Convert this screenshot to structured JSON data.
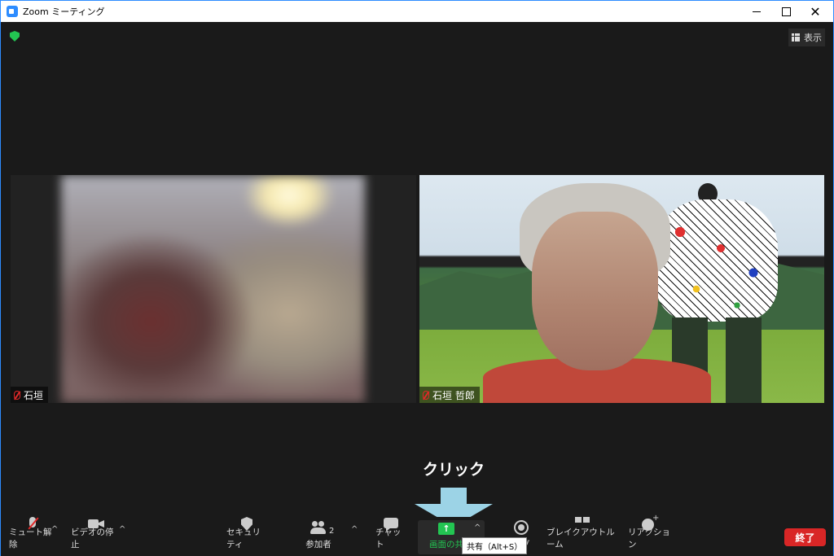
{
  "window": {
    "title": "Zoom ミーティング"
  },
  "meeting": {
    "view_label": "表示",
    "participants": [
      {
        "name": "石垣",
        "muted": true
      },
      {
        "name": "石垣 哲郎",
        "muted": true
      }
    ]
  },
  "annotation": {
    "label": "クリック"
  },
  "toolbar": {
    "mute_label": "ミュート解除",
    "video_label": "ビデオの停止",
    "security_label": "セキュリティ",
    "participants_label": "参加者",
    "participants_count": "2",
    "chat_label": "チャット",
    "share_label": "画面の共",
    "record_label": "ング",
    "breakout_label": "ブレイクアウトルーム",
    "reaction_label": "リアクション",
    "share_tooltip": "共有（Alt+S）",
    "end_label": "終了",
    "caret": "^"
  },
  "colors": {
    "accent": "#2d8cff",
    "share_green": "#23c552",
    "end_red": "#d92626",
    "arrow": "#9cd3e6"
  }
}
